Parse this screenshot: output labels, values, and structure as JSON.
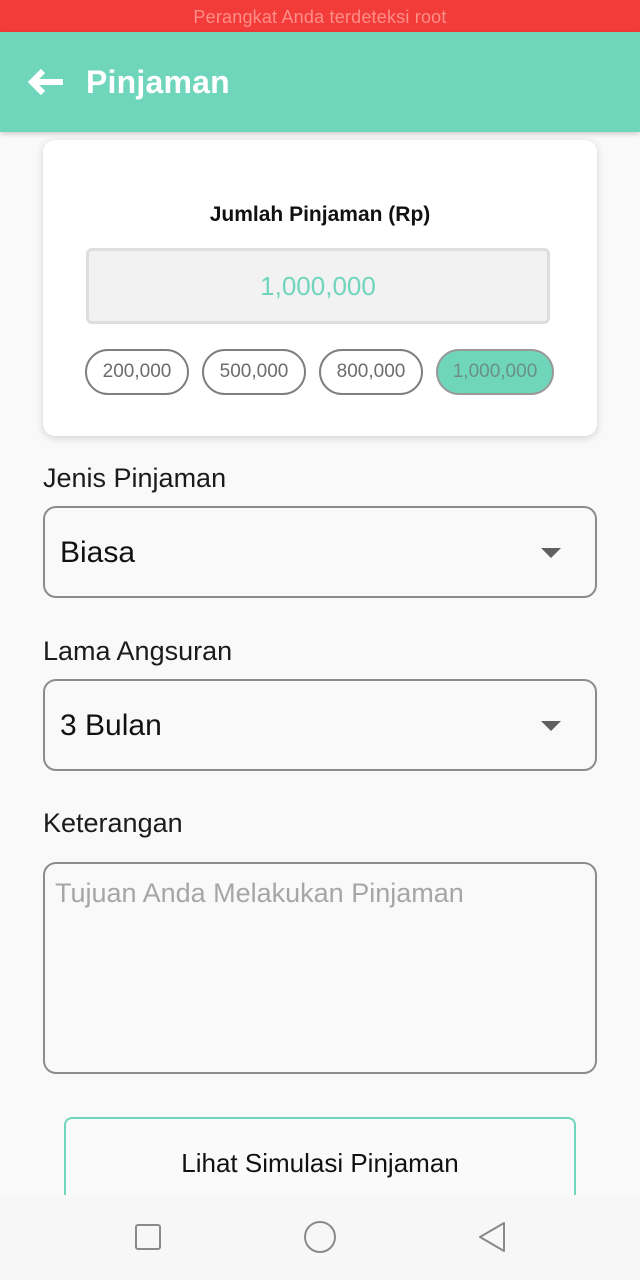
{
  "status_banner": {
    "text": "Perangkat Anda terdeteksi root"
  },
  "app_bar": {
    "title": "Pinjaman",
    "back_icon": "arrow-left-icon"
  },
  "loan_amount_card": {
    "title": "Jumlah Pinjaman (Rp)",
    "value": "1,000,000",
    "presets": [
      {
        "label": "200,000",
        "selected": false
      },
      {
        "label": "500,000",
        "selected": false
      },
      {
        "label": "800,000",
        "selected": false
      },
      {
        "label": "1,000,000",
        "selected": true
      }
    ]
  },
  "loan_type": {
    "label": "Jenis Pinjaman",
    "selected": "Biasa"
  },
  "installment_period": {
    "label": "Lama Angsuran",
    "selected": "3 Bulan"
  },
  "notes": {
    "label": "Keterangan",
    "value": "",
    "placeholder": "Tujuan Anda Melakukan Pinjaman"
  },
  "simulate_button": {
    "label": "Lihat Simulasi Pinjaman"
  },
  "nav_bar": {
    "icons": [
      "square-recents-icon",
      "circle-home-icon",
      "triangle-back-icon"
    ]
  },
  "colors": {
    "banner": "#f23c3a",
    "accent": "#6fd6bc",
    "background": "#f9f9f9"
  }
}
